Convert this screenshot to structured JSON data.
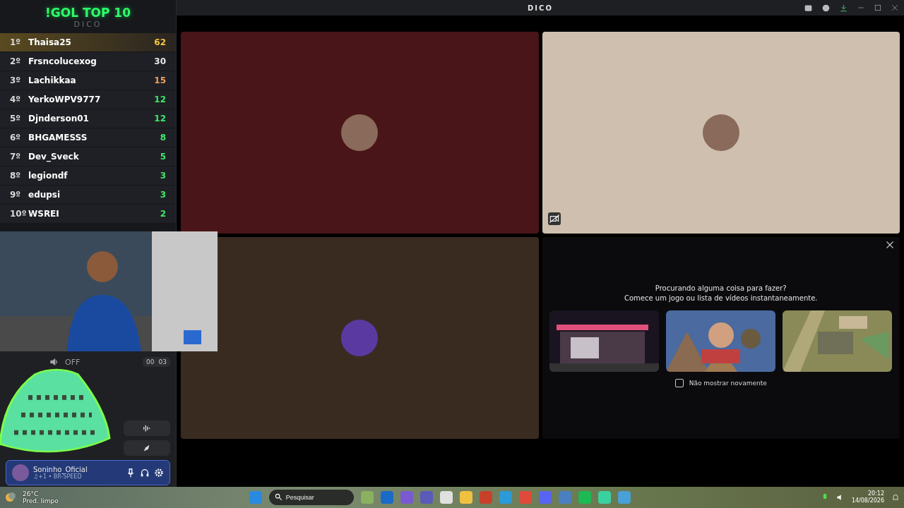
{
  "window": {
    "title": "DICO"
  },
  "leaderboard": {
    "title": "!GOL TOP 10",
    "server_name": "DICO",
    "entries": [
      {
        "rank": "1º",
        "name": "Thaisa25",
        "score": "62",
        "color": "#f5c542",
        "selected": true
      },
      {
        "rank": "2º",
        "name": "Frsncolucexog",
        "score": "30",
        "color": "#e8e8e8",
        "selected": false
      },
      {
        "rank": "3º",
        "name": "Lachikkaa",
        "score": "15",
        "color": "#f0a060",
        "selected": false
      },
      {
        "rank": "4º",
        "name": "YerkoWPV9777",
        "score": "12",
        "color": "#3ee86a",
        "selected": false
      },
      {
        "rank": "5º",
        "name": "Djnderson01",
        "score": "12",
        "color": "#3ee86a",
        "selected": false
      },
      {
        "rank": "6º",
        "name": "BHGAMESSS",
        "score": "8",
        "color": "#3ee86a",
        "selected": false
      },
      {
        "rank": "7º",
        "name": "Dev_Sveck",
        "score": "5",
        "color": "#3ee86a",
        "selected": false
      },
      {
        "rank": "8º",
        "name": "legiondf",
        "score": "3",
        "color": "#3ee86a",
        "selected": false
      },
      {
        "rank": "9º",
        "name": "edupsi",
        "score": "3",
        "color": "#3ee86a",
        "selected": false
      },
      {
        "rank": "10º",
        "name": "WSREI",
        "score": "2",
        "color": "#3ee86a",
        "selected": false
      }
    ]
  },
  "voice": {
    "status": "OFF",
    "timer": [
      "00",
      "03"
    ]
  },
  "user": {
    "name": "Soninho_Oficial",
    "status": "♫+1 • BR-SPEED"
  },
  "tiles": [
    {
      "color": "#4a1518",
      "video_off": false
    },
    {
      "color": "#cfbfae",
      "video_off": true
    },
    {
      "color": "#3a2b21",
      "video_off": false
    }
  ],
  "activity": {
    "heading": "Procurando alguma coisa para fazer?",
    "subheading": "Comece um jogo ou lista de vídeos instantaneamente.",
    "checkbox": {
      "label": "Não mostrar novamente",
      "checked": false
    }
  },
  "taskbar": {
    "weather": {
      "temp": "26°C",
      "desc": "Pred. limpo"
    },
    "search": {
      "placeholder": "Pesquisar"
    },
    "time": "20:12",
    "date": "14/08/2026"
  }
}
